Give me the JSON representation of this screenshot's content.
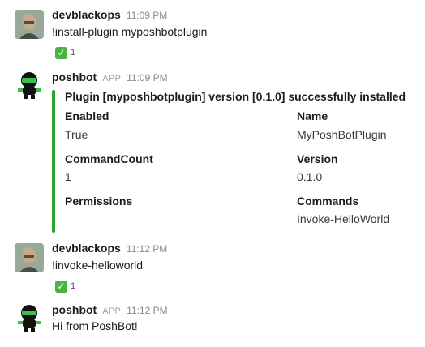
{
  "messages": [
    {
      "author": "devblackops",
      "time": "11:09 PM",
      "text": "!install-plugin myposhbotplugin",
      "reaction": {
        "icon": "check-mark-emoji",
        "count": "1"
      }
    },
    {
      "author": "poshbot",
      "app_tag": "APP",
      "time": "11:09 PM",
      "attachment": {
        "accent_color": "#2aa32a",
        "title": "Plugin [myposhbotplugin] version [0.1.0] successfully installed",
        "fields": [
          {
            "label": "Enabled",
            "value": "True"
          },
          {
            "label": "Name",
            "value": "MyPoshBotPlugin"
          },
          {
            "label": "CommandCount",
            "value": "1"
          },
          {
            "label": "Version",
            "value": "0.1.0"
          },
          {
            "label": "Permissions",
            "value": ""
          },
          {
            "label": "Commands",
            "value": "Invoke-HelloWorld"
          }
        ]
      }
    },
    {
      "author": "devblackops",
      "time": "11:12 PM",
      "text": "!invoke-helloworld",
      "reaction": {
        "icon": "check-mark-emoji",
        "count": "1"
      }
    },
    {
      "author": "poshbot",
      "app_tag": "APP",
      "time": "11:12 PM",
      "text": "Hi from PoshBot!"
    }
  ],
  "colors": {
    "reaction_check": "#4cb33f",
    "bot_green": "#39c24a"
  }
}
